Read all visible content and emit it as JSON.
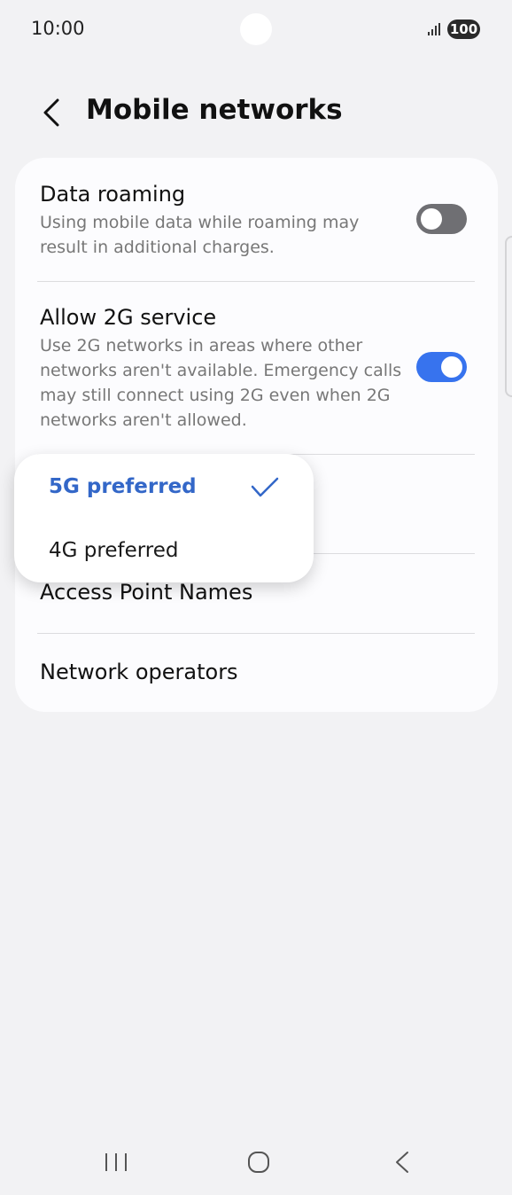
{
  "status_bar": {
    "time": "10:00",
    "battery": "100",
    "signal_icon": "signal-bars-icon"
  },
  "header": {
    "title": "Mobile networks",
    "back_icon": "chevron-left-icon"
  },
  "settings": {
    "data_roaming": {
      "title": "Data roaming",
      "subtitle_line1": "Using mobile data while roaming may",
      "subtitle_line2": "result in additional charges.",
      "enabled": false
    },
    "allow_2g": {
      "title": "Allow 2G service",
      "subtitle_line1": "Use 2G networks in areas where other",
      "subtitle_line2": "networks aren't available. Emergency calls",
      "subtitle_line3": "may still connect using 2G even when 2G",
      "subtitle_line4": "networks aren't allowed.",
      "enabled": true
    },
    "access_point_names": {
      "title": "Access Point Names"
    },
    "network_operators": {
      "title": "Network operators"
    }
  },
  "network_mode_popup": {
    "options": [
      {
        "label": "5G preferred",
        "selected": true
      },
      {
        "label": "4G preferred",
        "selected": false
      }
    ],
    "check_icon": "checkmark-icon"
  },
  "colors": {
    "accent": "#3773ee",
    "selected_text": "#3367c8",
    "background": "#f2f2f4",
    "card": "#fcfcfe"
  },
  "nav_bar": {
    "recent_icon": "recent-apps-icon",
    "home_icon": "home-icon",
    "back_icon": "back-icon"
  }
}
